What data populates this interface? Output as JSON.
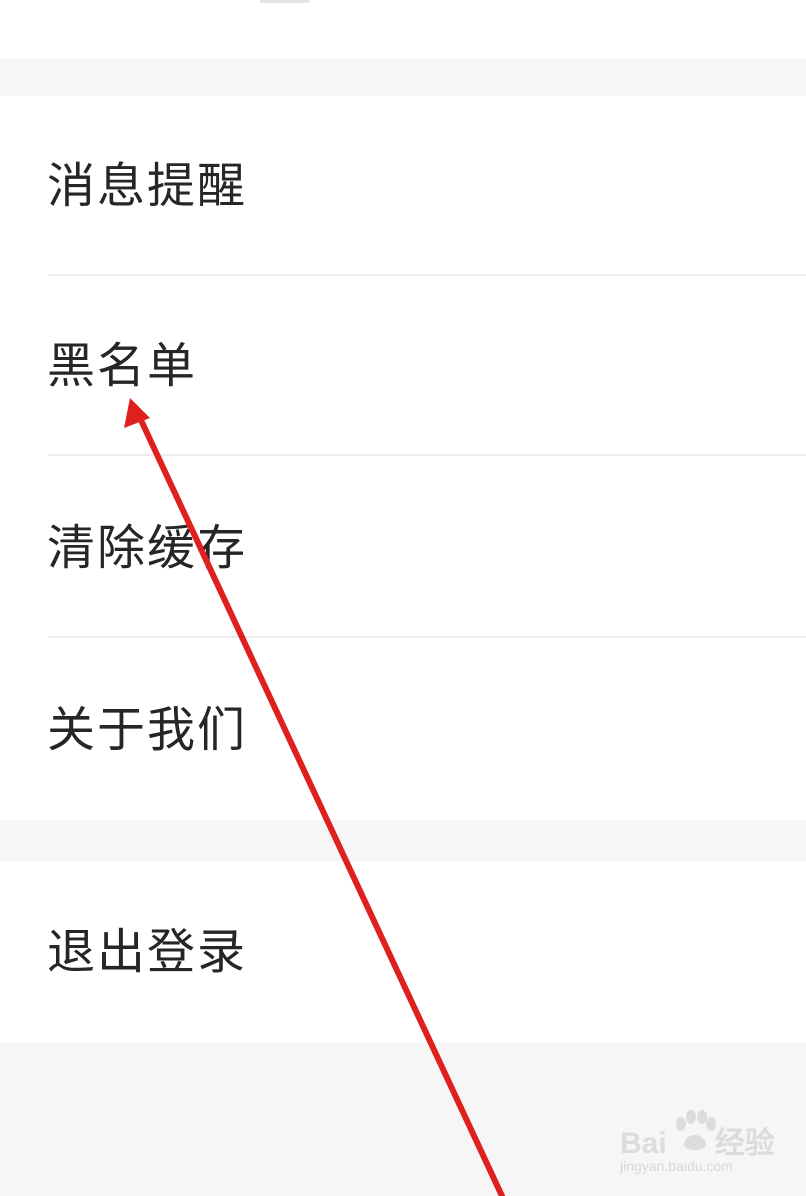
{
  "settings": {
    "items": [
      {
        "label": "消息提醒"
      },
      {
        "label": "黑名单"
      },
      {
        "label": "清除缓存"
      },
      {
        "label": "关于我们"
      }
    ],
    "logout_label": "退出登录"
  },
  "annotation": {
    "color": "#e0201e",
    "points_to": "黑名单"
  },
  "watermark": {
    "brand": "Bai",
    "brand_suffix": "经验",
    "url": "jingyan.baidu.com"
  }
}
